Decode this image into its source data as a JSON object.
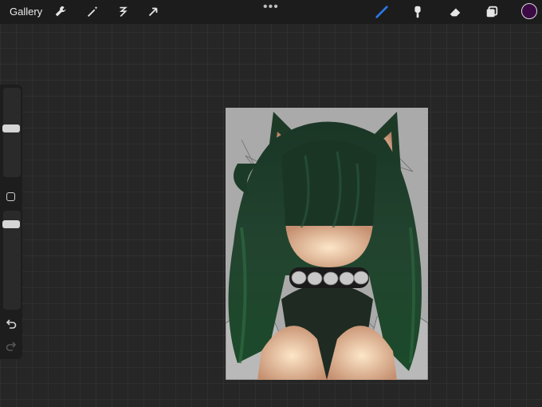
{
  "toolbar": {
    "gallery_label": "Gallery",
    "left_tools": [
      "wrench-icon",
      "magic-wand-icon",
      "selection-icon",
      "transform-icon"
    ],
    "right_tools": [
      "brush-icon",
      "smudge-icon",
      "eraser-icon",
      "layers-icon"
    ],
    "active_tool": "brush",
    "brush_color": "#2d77e6",
    "current_color": "#3b0a45",
    "more_label": "•••"
  },
  "sidebar": {
    "brush_size_level": 0.5,
    "opacity_level": 0.85
  },
  "colors": {
    "canvas_bg": "#aaaaaa",
    "hair": "#1f3d2a",
    "skin": "#e9c4a2"
  }
}
